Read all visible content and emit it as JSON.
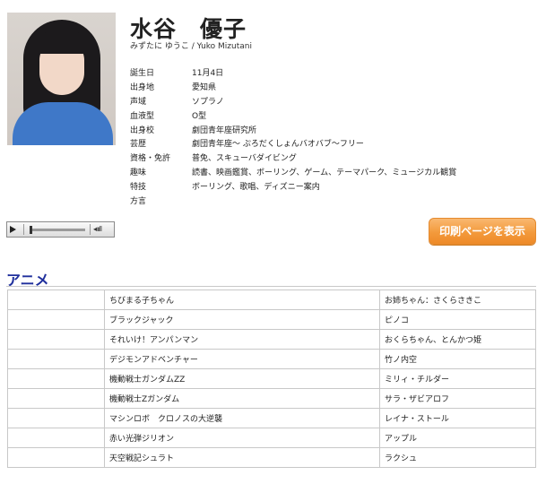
{
  "profile": {
    "name": "水谷　優子",
    "kana": "みずたに ゆうこ / Yuko Mizutani",
    "details": [
      {
        "label": "誕生日",
        "value": "11月4日"
      },
      {
        "label": "出身地",
        "value": "愛知県"
      },
      {
        "label": "声域",
        "value": "ソプラノ"
      },
      {
        "label": "血液型",
        "value": "O型"
      },
      {
        "label": "出身校",
        "value": "劇団青年座研究所"
      },
      {
        "label": "芸歴",
        "value": "劇団青年座～ ぷろだくしょんバオバブ～フリー"
      },
      {
        "label": "資格・免許",
        "value": "普免、スキューバダイビング"
      },
      {
        "label": "趣味",
        "value": "読書、映画鑑賞、ボーリング、ゲーム、テーマパーク、ミュージカル観賞"
      },
      {
        "label": "特技",
        "value": "ボーリング、歌唱、ディズニー案内"
      },
      {
        "label": "方言",
        "value": ""
      }
    ]
  },
  "player": {
    "play_icon": "play-icon",
    "volume_glyph": "◂ıııll"
  },
  "print_button": {
    "label": "印刷ページを表示"
  },
  "section": {
    "title": "アニメ"
  },
  "roles": [
    {
      "year": "",
      "title": "ちびまる子ちゃん",
      "role": "お姉ちゃん：さくらさきこ"
    },
    {
      "year": "",
      "title": "ブラックジャック",
      "role": "ピノコ"
    },
    {
      "year": "",
      "title": "それいけ！アンパンマン",
      "role": "おくらちゃん、とんかつ姫"
    },
    {
      "year": "",
      "title": "デジモンアドベンチャー",
      "role": "竹ノ内空"
    },
    {
      "year": "",
      "title": "機動戦士ガンダムZZ",
      "role": "ミリィ・チルダー"
    },
    {
      "year": "",
      "title": "機動戦士Zガンダム",
      "role": "サラ・ザビアロフ"
    },
    {
      "year": "",
      "title": "マシンロボ　クロノスの大逆襲",
      "role": "レイナ・ストール"
    },
    {
      "year": "",
      "title": "赤い光弾ジリオン",
      "role": "アップル"
    },
    {
      "year": "",
      "title": "天空戦記シュラト",
      "role": "ラクシュ"
    }
  ]
}
